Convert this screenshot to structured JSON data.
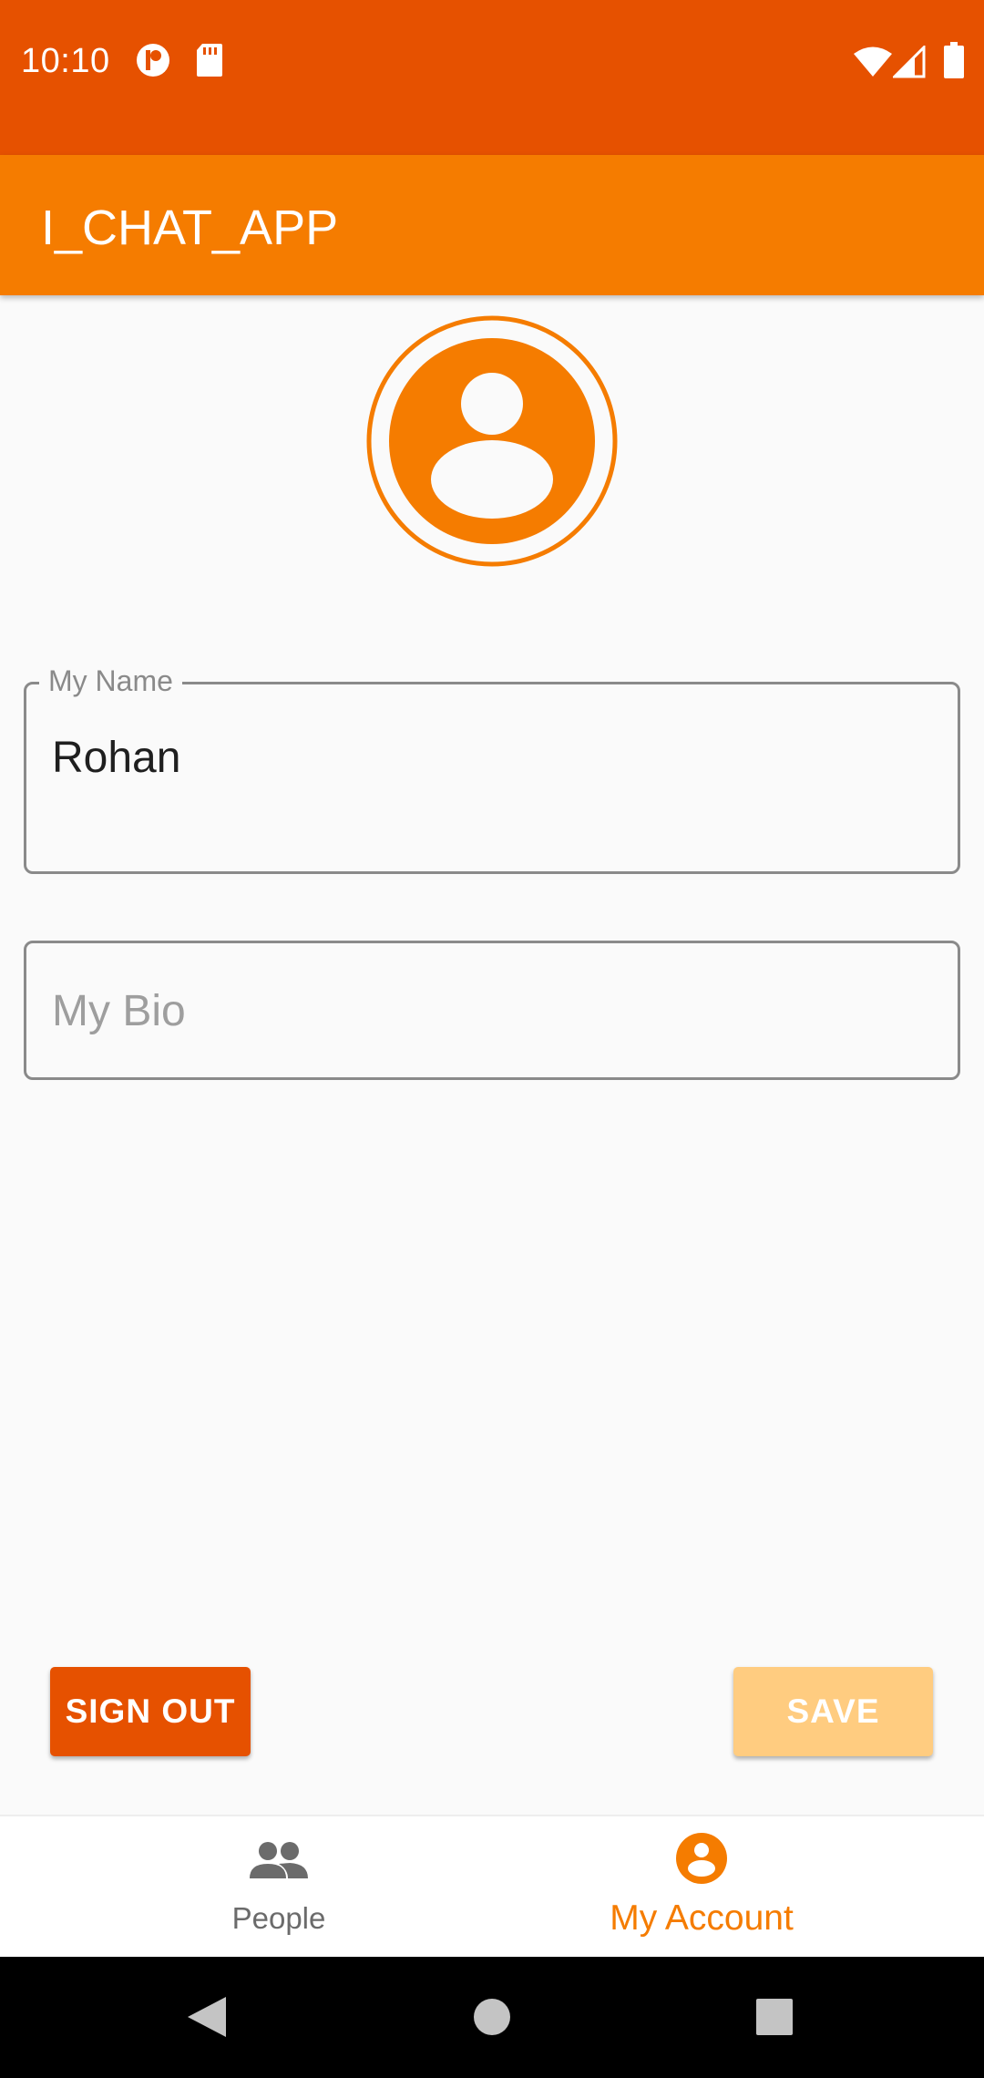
{
  "status_bar": {
    "time": "10:10",
    "icons": [
      "notification-icon",
      "sd-card-icon",
      "wifi-icon",
      "signal-icon",
      "battery-icon"
    ],
    "background": "#e65100"
  },
  "app_bar": {
    "title": "I_CHAT_APP",
    "background": "#f57c00"
  },
  "profile": {
    "avatar_icon": "account-circle-icon",
    "name_field": {
      "label": "My Name",
      "value": "Rohan"
    },
    "bio_field": {
      "placeholder": "My Bio",
      "value": ""
    }
  },
  "actions": {
    "sign_out_label": "SIGN OUT",
    "save_label": "SAVE"
  },
  "bottom_nav": {
    "items": [
      {
        "label": "People",
        "icon": "people-icon",
        "active": false
      },
      {
        "label": "My Account",
        "icon": "account-circle-icon",
        "active": true
      }
    ]
  },
  "system_nav": {
    "icons": [
      "back-icon",
      "home-icon",
      "recents-icon"
    ]
  },
  "colors": {
    "accent": "#f57c00",
    "primary_dark": "#e65100",
    "save_disabled": "#ffcc80",
    "inactive_nav": "#6b6b6b"
  }
}
